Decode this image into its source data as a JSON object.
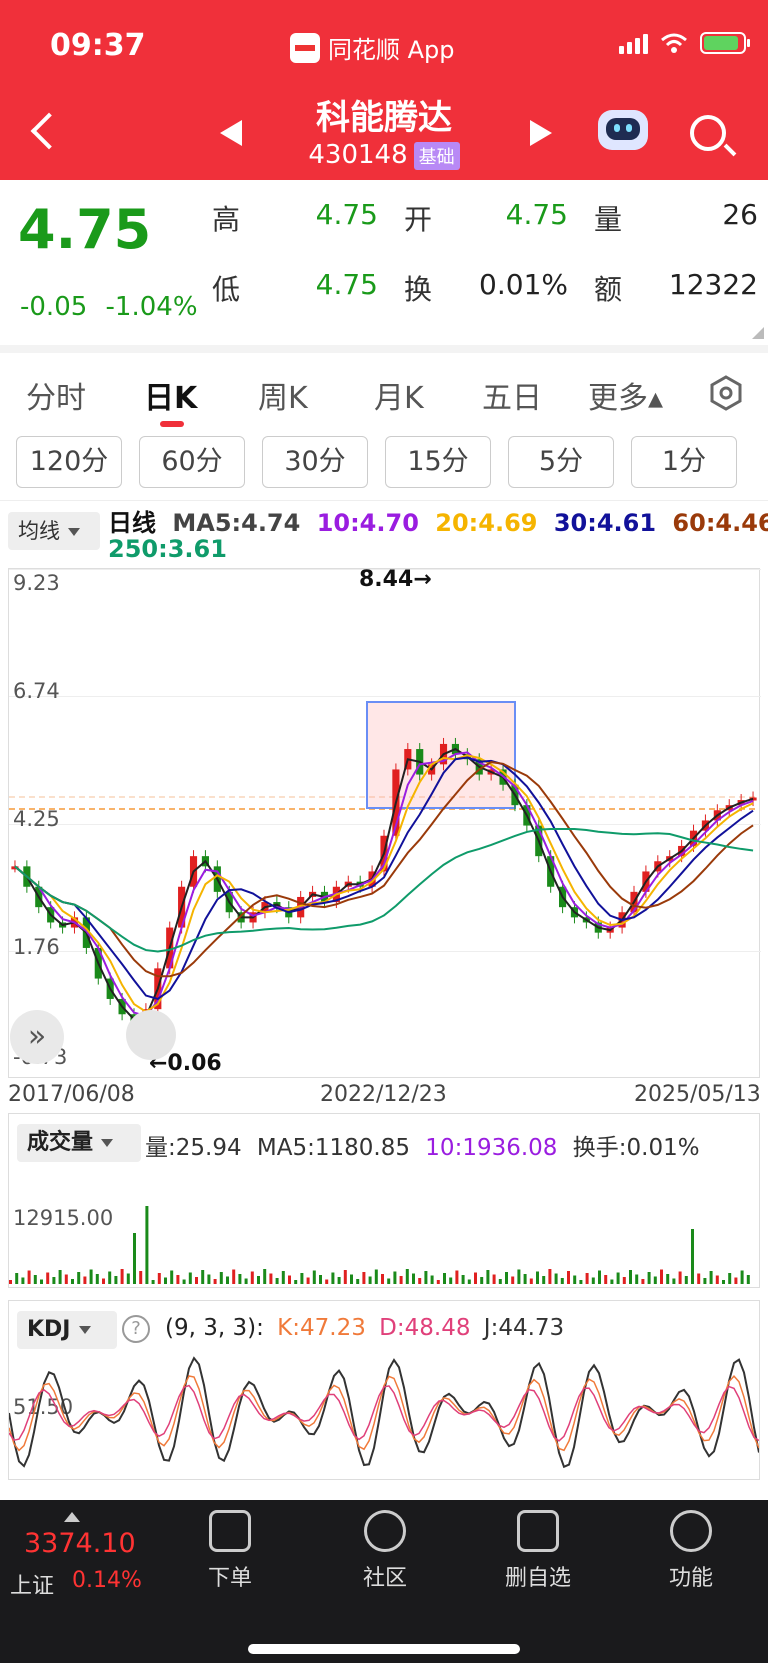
{
  "status": {
    "time": "09:37",
    "app_name": "同花顺 App"
  },
  "header": {
    "title": "科能腾达",
    "code": "430148",
    "badge": "基础"
  },
  "quote": {
    "price": "4.75",
    "change": "-0.05",
    "change_pct": "-1.04%",
    "labels": {
      "high": "高",
      "open": "开",
      "volume": "量",
      "low": "低",
      "turnover": "换",
      "amount": "额"
    },
    "high": "4.75",
    "open": "4.75",
    "volume": "26",
    "low": "4.75",
    "turnover": "0.01%",
    "amount": "12322"
  },
  "tabs": [
    "分时",
    "日K",
    "周K",
    "月K",
    "五日",
    "更多▴"
  ],
  "active_tab": "日K",
  "periods": [
    "120分",
    "60分",
    "30分",
    "15分",
    "5分",
    "1分"
  ],
  "ma_bar": {
    "select": "均线",
    "label": "日线",
    "ma5": "MA5:4.74",
    "ma10": "10:4.70",
    "ma20": "20:4.69",
    "ma30": "30:4.61",
    "ma60": "60:4.46",
    "ma250": "250:3.61"
  },
  "chart_data": {
    "type": "candlestick",
    "y_ticks": [
      "9.23",
      "6.74",
      "4.25",
      "1.76",
      "-0.73"
    ],
    "x_ticks": [
      "2017/06/08",
      "2022/12/23",
      "2025/05/13"
    ],
    "ylim": [
      -0.73,
      9.23
    ],
    "annotations": {
      "max": "8.44→",
      "min": "←0.06"
    },
    "close_series": [
      3.4,
      3.0,
      2.6,
      2.3,
      2.2,
      2.4,
      1.8,
      1.2,
      0.8,
      0.5,
      0.3,
      0.6,
      1.4,
      2.2,
      3.0,
      3.6,
      3.4,
      2.9,
      2.5,
      2.3,
      2.5,
      2.7,
      2.6,
      2.4,
      2.8,
      2.9,
      2.7,
      3.0,
      3.1,
      3.0,
      3.3,
      4.0,
      5.3,
      5.7,
      5.2,
      5.4,
      5.8,
      5.6,
      5.5,
      5.2,
      5.3,
      5.0,
      4.6,
      4.2,
      3.6,
      3.0,
      2.6,
      2.4,
      2.3,
      2.1,
      2.2,
      2.5,
      2.9,
      3.3,
      3.5,
      3.6,
      3.8,
      4.1,
      4.3,
      4.5,
      4.6,
      4.7,
      4.75
    ],
    "ma_colors": {
      "ma5": "#222222",
      "ma10": "#9a1de0",
      "ma20": "#f5b400",
      "ma30": "#11119a",
      "ma60": "#9a3a0a",
      "ma250": "#0f9b6a"
    }
  },
  "volume": {
    "select": "成交量",
    "info_vol": "量:25.94",
    "info_ma5": "MA5:1180.85",
    "info_ma10": "10:1936.08",
    "info_turn": "换手:0.01%",
    "ylabel": "12915.00"
  },
  "kdj": {
    "select": "KDJ",
    "help": "?",
    "params": "(9, 3, 3):",
    "k": "K:47.23",
    "d": "D:48.48",
    "j": "J:44.73",
    "ylabel": "51.50"
  },
  "bottom": {
    "index_value": "3374.10",
    "index_name": "上证",
    "index_pct": "0.14%",
    "nav": [
      "下单",
      "社区",
      "删自选",
      "功能"
    ]
  }
}
